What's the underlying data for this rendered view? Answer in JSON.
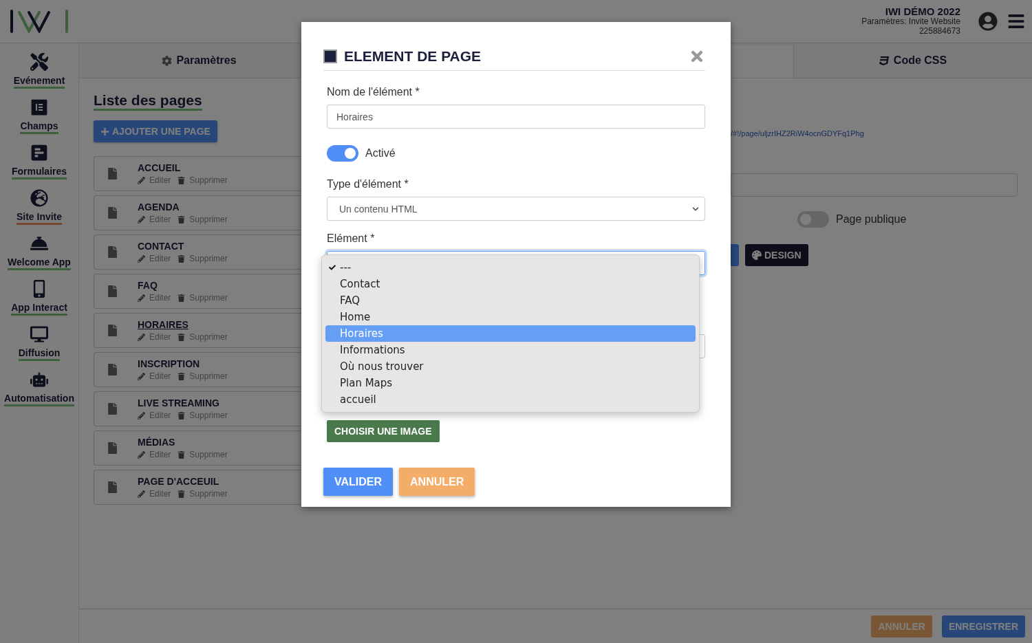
{
  "header": {
    "account_title": "IWI DÉMO 2022",
    "account_subtitle": "Paramètres: Invite Website",
    "account_id": "225884673"
  },
  "sidebar": {
    "items": [
      {
        "label": "Evénement",
        "selected": false
      },
      {
        "label": "Champs",
        "selected": false
      },
      {
        "label": "Formulaires",
        "selected": false
      },
      {
        "label": "Site Invite",
        "selected": true
      },
      {
        "label": "Welcome App",
        "selected": false
      },
      {
        "label": "App Interact",
        "selected": false
      },
      {
        "label": "Diffusion",
        "selected": false
      },
      {
        "label": "Automatisation",
        "selected": false
      }
    ]
  },
  "tabs": [
    {
      "label": "Paramètres"
    },
    {
      "label": "Code CSS"
    }
  ],
  "pages_panel": {
    "title": "Liste des pages",
    "add_button": "AJOUTER UNE PAGE",
    "pages": [
      {
        "name": "ACCUEIL",
        "hovered": false,
        "edit_label": "Editer",
        "delete_label": "Supprimer"
      },
      {
        "name": "AGENDA",
        "hovered": false,
        "edit_label": "Editer",
        "delete_label": "Supprimer"
      },
      {
        "name": "CONTACT",
        "hovered": false,
        "edit_label": "Editer",
        "delete_label": "Supprimer"
      },
      {
        "name": "FAQ",
        "hovered": false,
        "edit_label": "Editer",
        "delete_label": "Supprimer"
      },
      {
        "name": "HORAIRES",
        "hovered": true,
        "edit_label": "Editer",
        "delete_label": "Supprimer"
      },
      {
        "name": "INSCRIPTION",
        "hovered": false,
        "edit_label": "Editer",
        "delete_label": "Supprimer"
      },
      {
        "name": "LIVE STREAMING",
        "hovered": false,
        "edit_label": "Editer",
        "delete_label": "Supprimer"
      },
      {
        "name": "MÉDIAS",
        "hovered": false,
        "edit_label": "Editer",
        "delete_label": "Supprimer"
      },
      {
        "name": "PAGE D'ACCEUIL",
        "hovered": false,
        "edit_label": "Editer",
        "delete_label": "Supprimer"
      }
    ]
  },
  "page_settings": {
    "link": "/#!/page/uljzrIHZ2RiW4ocnGDYFq1Phg",
    "public_label": "Page publique",
    "public_on": false,
    "design_button": "DESIGN"
  },
  "footer": {
    "buttons": [
      {
        "label": "ANNULER",
        "kind": "cancel"
      },
      {
        "label": "ENREGISTRER",
        "kind": "save"
      }
    ]
  },
  "modal": {
    "title": "ELEMENT DE PAGE",
    "name_label": "Nom de l'élément *",
    "name_value": "Horaires",
    "active_label": "Activé",
    "active_on": true,
    "type_label": "Type d'élément *",
    "type_value": "Un contenu HTML",
    "element_label": "Elément *",
    "element_options": [
      {
        "label": "---",
        "checked": true,
        "highlighted": false
      },
      {
        "label": "Contact",
        "checked": false,
        "highlighted": false
      },
      {
        "label": "FAQ",
        "checked": false,
        "highlighted": false
      },
      {
        "label": "Home",
        "checked": false,
        "highlighted": false
      },
      {
        "label": "Horaires",
        "checked": false,
        "highlighted": true
      },
      {
        "label": "Informations",
        "checked": false,
        "highlighted": false
      },
      {
        "label": "Où nous trouver",
        "checked": false,
        "highlighted": false
      },
      {
        "label": "Plan Maps",
        "checked": false,
        "highlighted": false
      },
      {
        "label": "accueil",
        "checked": false,
        "highlighted": false
      }
    ],
    "image_button": "CHOISIR UNE IMAGE",
    "buttons": [
      {
        "label": "VALIDER",
        "kind": "confirm"
      },
      {
        "label": "ANNULER",
        "kind": "cancel"
      }
    ]
  }
}
